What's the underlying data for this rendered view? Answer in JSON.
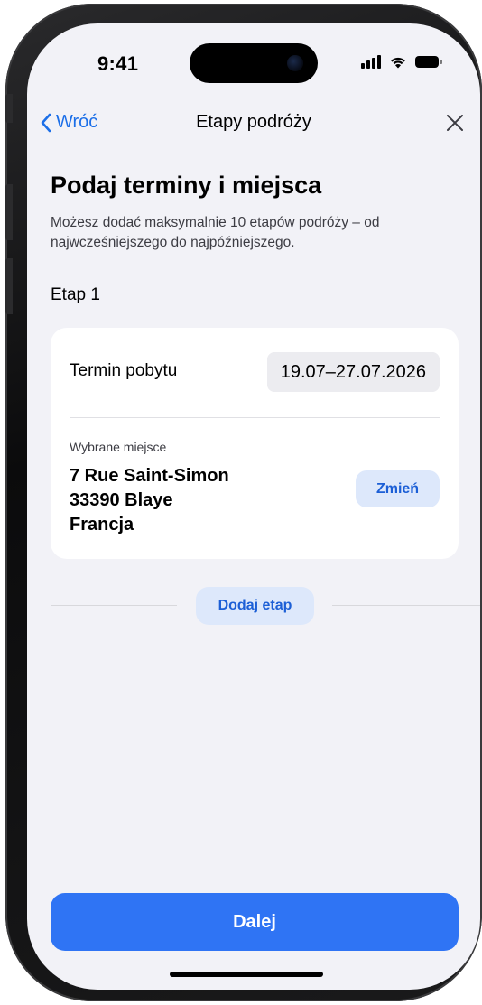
{
  "status_bar": {
    "time": "9:41",
    "icons": [
      "signal-icon",
      "wifi-icon",
      "battery-icon"
    ]
  },
  "nav": {
    "back_label": "Wróć",
    "title": "Etapy podróży",
    "close_icon": "close-icon"
  },
  "heading": "Podaj terminy i miejsca",
  "subtitle": "Możesz dodać maksymalnie 10 etapów podróży – od najwcześniejszego do najpóźniejszego.",
  "stage": {
    "label": "Etap 1",
    "stay_label": "Termin pobytu",
    "stay_dates": "19.07–27.07.2026",
    "place_caption": "Wybrane miejsce",
    "address_line1": "7 Rue Saint-Simon",
    "address_line2": "33390 Blaye",
    "address_line3": "Francja",
    "change_label": "Zmień"
  },
  "add_stage_label": "Dodaj etap",
  "next_label": "Dalej",
  "colors": {
    "accent": "#2f74f4",
    "link": "#1c6fe8",
    "secondary_button_bg": "#dde8fb",
    "screen_bg": "#f2f2f7"
  }
}
